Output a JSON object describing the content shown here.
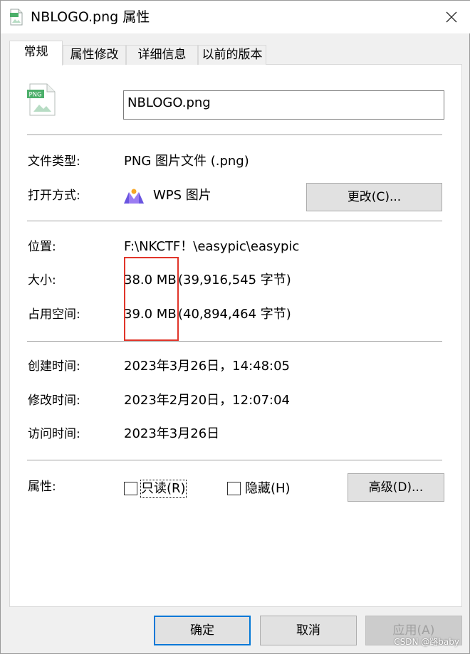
{
  "window": {
    "title": "NBLOGO.png 属性",
    "close_glyph": "✕"
  },
  "tabs": [
    {
      "label": "常规",
      "active": true
    },
    {
      "label": "属性修改",
      "active": false
    },
    {
      "label": "详细信息",
      "active": false
    },
    {
      "label": "以前的版本",
      "active": false
    }
  ],
  "file": {
    "name": "NBLOGO.png",
    "icon_badge": "PNG"
  },
  "type_section": {
    "file_type_label": "文件类型:",
    "file_type_value": "PNG 图片文件 (.png)",
    "open_with_label": "打开方式:",
    "open_with_value": "WPS 图片",
    "change_button": "更改(C)..."
  },
  "location_section": {
    "location_label": "位置:",
    "location_value": "F:\\NKCTF！\\easypic\\easypic",
    "size_label": "大小:",
    "size_value": "38.0 MB",
    "size_bytes": "(39,916,545 字节)",
    "disk_label": "占用空间:",
    "disk_value": "39.0 MB",
    "disk_bytes": "(40,894,464 字节)"
  },
  "time_section": {
    "created_label": "创建时间:",
    "created_value": "2023年3月26日，14:48:05",
    "modified_label": "修改时间:",
    "modified_value": "2023年2月20日，12:07:04",
    "accessed_label": "访问时间:",
    "accessed_value": "2023年3月26日"
  },
  "attributes": {
    "label": "属性:",
    "readonly_label": "只读(R)",
    "readonly_checked": false,
    "hidden_label": "隐藏(H)",
    "hidden_checked": false,
    "advanced_button": "高级(D)..."
  },
  "footer": {
    "ok": "确定",
    "cancel": "取消",
    "apply": "应用(A)"
  },
  "watermark": "CSDN @路baby",
  "colors": {
    "highlight_box": "#e0352a",
    "default_button_border": "#0078d7",
    "png_icon_green": "#4caf6a"
  },
  "icons": [
    "png-file-icon",
    "close-icon",
    "wps-image-icon"
  ]
}
